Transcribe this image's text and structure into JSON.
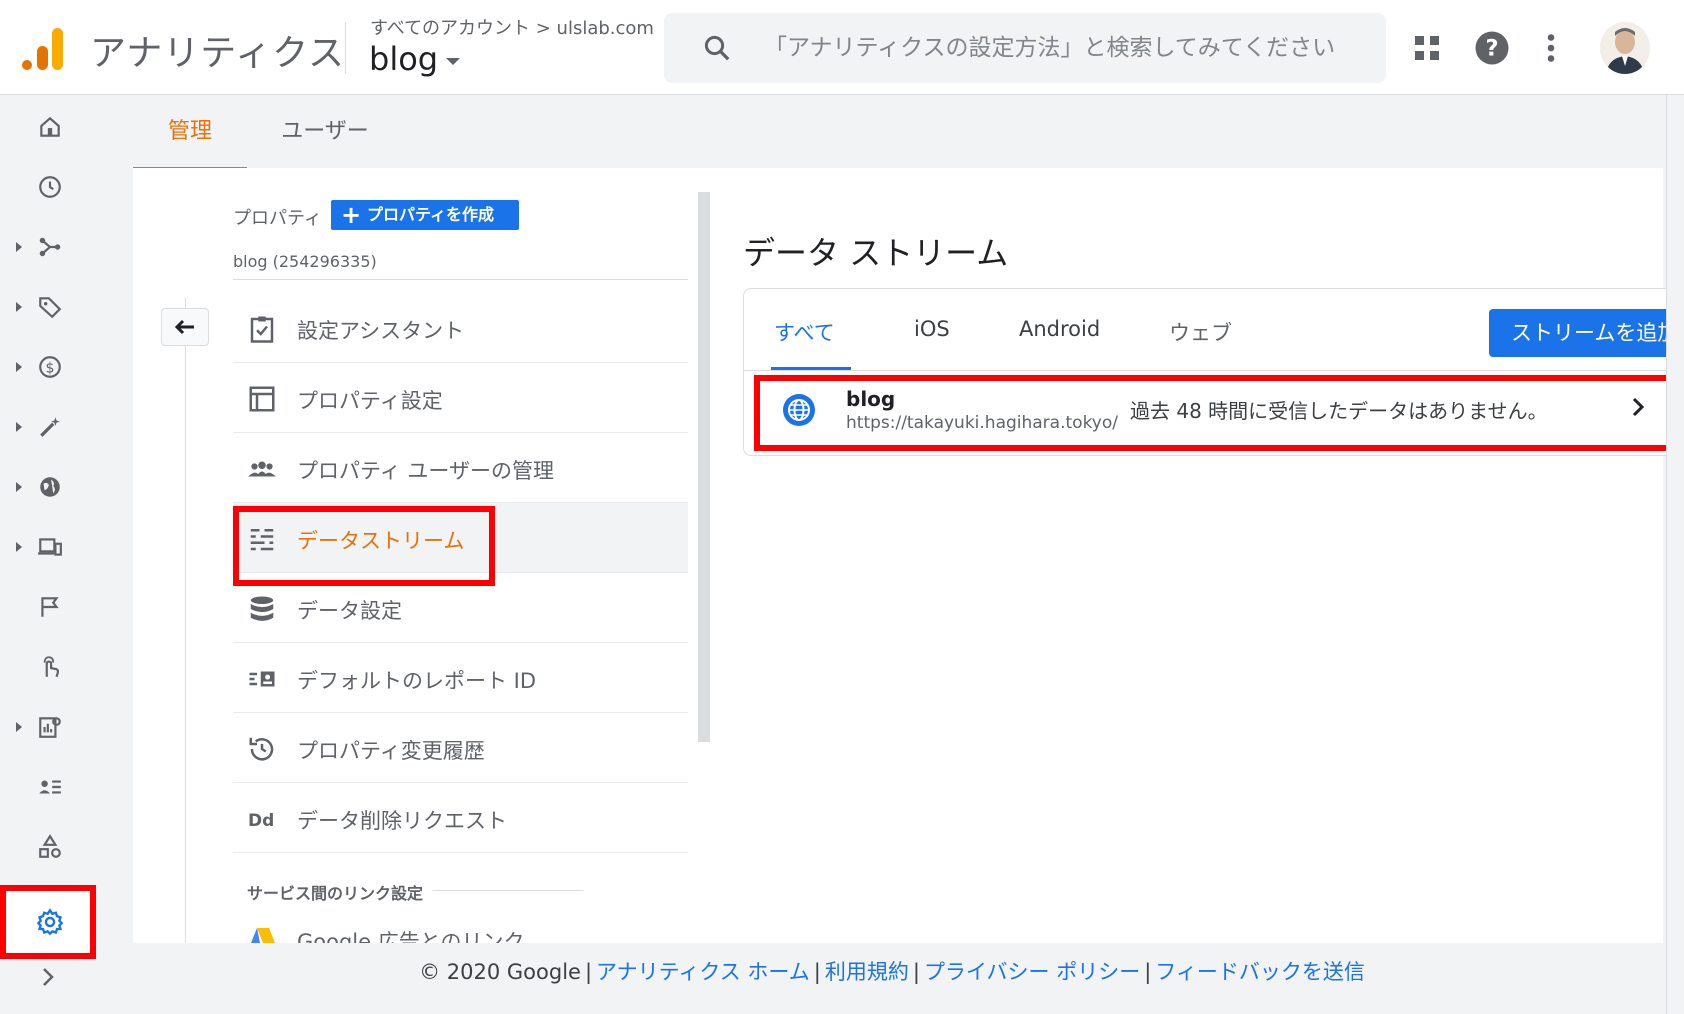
{
  "header": {
    "app_title": "アナリティクス",
    "account_breadcrumb": "すべてのアカウント > ulslab.com",
    "property_name": "blog",
    "search_placeholder": "「アナリティクスの設定方法」と検索してみてください",
    "colors": {
      "logo_orange": "#f9ab00",
      "logo_dark_orange": "#e37400"
    }
  },
  "rail": {
    "icons": [
      "home-icon",
      "clock-icon",
      "flow-icon",
      "tag-icon",
      "dollar-icon",
      "wand-icon",
      "globe-icon",
      "devices-icon",
      "flag-icon",
      "touch-icon",
      "report-search-icon",
      "user-list-icon",
      "shapes-icon",
      "gear-icon",
      "chevron-right-icon"
    ]
  },
  "tabs": {
    "admin": "管理",
    "user": "ユーザー"
  },
  "property": {
    "label": "プロパティ",
    "create_button": "プロパティを作成",
    "id": "blog (254296335)"
  },
  "menu": [
    {
      "label": "設定アシスタント",
      "icon": "checklist-icon"
    },
    {
      "label": "プロパティ設定",
      "icon": "layout-icon"
    },
    {
      "label": "プロパティ ユーザーの管理",
      "icon": "people-icon"
    },
    {
      "label": "データストリーム",
      "icon": "streams-icon"
    },
    {
      "label": "データ設定",
      "icon": "database-icon"
    },
    {
      "label": "デフォルトのレポート ID",
      "icon": "report-id-icon"
    },
    {
      "label": "プロパティ変更履歴",
      "icon": "history-icon"
    },
    {
      "label": "データ削除リクエスト",
      "icon": "dd-icon"
    }
  ],
  "section": {
    "header": "サービス間のリンク設定",
    "google_ads_link": "Google 広告とのリンク"
  },
  "streams": {
    "title": "データ ストリーム",
    "tabs": [
      "すべて",
      "iOS",
      "Android",
      "ウェブ"
    ],
    "add_button": "ストリームを追加",
    "rows": [
      {
        "name": "blog",
        "url": "https://takayuki.hagihara.tokyo/",
        "status": "過去 48 時間に受信したデータはありません。"
      }
    ]
  },
  "footer": {
    "copyright": "© 2020 Google",
    "links": [
      "アナリティクス ホーム",
      "利用規約",
      "プライバシー ポリシー",
      "フィードバックを送信"
    ]
  }
}
